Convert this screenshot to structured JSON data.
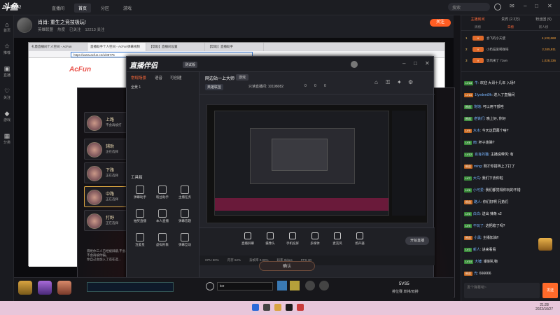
{
  "topbar": {
    "tabs": [
      "直播间",
      "首页",
      "分区",
      "游戏",
      "赛事",
      "下载"
    ],
    "search_placeholder": "搜索"
  },
  "leftnav": {
    "items": [
      "首页",
      "推荐",
      "直播",
      "关注",
      "游戏",
      "分类"
    ]
  },
  "header": {
    "room_id": "10198082",
    "title": "肖肖: 重生之竞技极玩!",
    "meta": [
      "英雄联盟",
      "热度",
      "已关注",
      "12213 关注"
    ],
    "follow_label": "关注"
  },
  "browser": {
    "tabs": [
      "礼量直播间个人空间 - AcFun",
      "直播助手个人空间 - AcFun弹幕视频",
      "【帮助】直播间设置",
      "【帮助】直播助手"
    ],
    "url": "https://www.acfun.cn/u/38775",
    "site": "AcFun"
  },
  "heroes": [
    {
      "name": "上路",
      "sub": "不会再被打"
    },
    {
      "name": "辅助",
      "sub": "正在选择"
    },
    {
      "name": "下路",
      "sub": "正在选择"
    },
    {
      "name": "中路",
      "sub": "正在选择"
    },
    {
      "name": "打野",
      "sub": "正在选择"
    }
  ],
  "assistant": {
    "logo": "直播伴侣",
    "beta": "测试版",
    "scene_tabs": [
      "常规场景",
      "语音",
      "可创建"
    ],
    "scene_item": "全景 1",
    "tools_title": "工具箱",
    "tools": [
      "弹幕助手",
      "粉丝助手",
      "主播任务",
      "抽奖直播",
      "本人直播",
      "弹幕答题",
      "连麦星",
      "虚拟形象",
      "弹幕互动"
    ],
    "room_title": "网边站一上大师",
    "room_tag": "游戏",
    "room_category": "英雄联盟",
    "room_id_label": "只读直播间: 10198082",
    "stats": [
      "0",
      "0",
      "0"
    ],
    "controls": [
      "直播屏幕",
      "摄像头",
      "手机投屏",
      "多媒体",
      "麦克风",
      "扬声器"
    ],
    "start_label": "开始直播",
    "status": [
      "CPU 30%",
      "内存 62%",
      "丢帧率 0.00%",
      "码率 0kbps",
      "FPS 30"
    ]
  },
  "game": {
    "chat_lines": [
      "隔绝你三人已经被屏蔽,不会再继续看到他们的消息",
      "不会再被你骗。",
      "你自己会加入了还在选..."
    ],
    "search_text": "ice",
    "confirm_label": "确认",
    "score": "5VS5",
    "rank_label": "排位赛 单排/双排"
  },
  "right": {
    "tabs": [
      "主播房间",
      "贵宾 (2.3万)",
      "粉丝团 (9)"
    ],
    "rank_tabs": [
      "周榜",
      "日榜",
      "新人榜"
    ],
    "rank": [
      {
        "n": "1",
        "name": "会飞的小天使",
        "score": "4,132,668"
      },
      {
        "n": "2",
        "name": "小奶猫爱喝咖啡",
        "score": "2,345,811"
      },
      {
        "n": "3",
        "name": "等风来了 71wn",
        "score": "1,028,336"
      }
    ],
    "chat": [
      {
        "badge": "LV18",
        "name": "牛",
        "text": "欢迎 大哥十几年 入场!!"
      },
      {
        "badge": "LV10",
        "name": "1fyvdent9h",
        "text": "进入了直播间"
      },
      {
        "badge": "粉丝",
        "name": "饱饱",
        "text": "可以用干部哇"
      },
      {
        "badge": "粉丝",
        "name": "老铁们",
        "text": "晚上好, 你好"
      },
      {
        "badge": "LV9",
        "name": "木木",
        "text": "今天这屏幕个啥?"
      },
      {
        "badge": "LV8",
        "name": "雨",
        "text": "杯子连弹?"
      },
      {
        "badge": "LV12",
        "name": "肖肖的猫",
        "text": "主播说带风: 有"
      },
      {
        "badge": "粉丝",
        "name": "ming",
        "text": "刚才你搭档上了打了"
      },
      {
        "badge": "LV7",
        "name": "大鸟",
        "text": "我们下去你啦"
      },
      {
        "badge": "LV6",
        "name": "小可爱",
        "text": "我们都觉得你玩的不错"
      },
      {
        "badge": "粉丝",
        "name": "路人",
        "text": "你们好啊 兄弟们"
      },
      {
        "badge": "LV5",
        "name": "白白",
        "text": "送出 辣条 x2"
      },
      {
        "badge": "LV9",
        "name": "不玩了",
        "text": "这把稳了吗?"
      },
      {
        "badge": "粉丝",
        "name": "小黑",
        "text": "主播加油!!"
      },
      {
        "badge": "LV3",
        "name": "新人",
        "text": "进来看看"
      },
      {
        "badge": "LV10",
        "name": "大锤",
        "text": "谢谢礼物"
      },
      {
        "badge": "粉丝",
        "name": "光",
        "text": "666666"
      }
    ],
    "input_placeholder": "发个弹幕吧~",
    "send_label": "发送"
  },
  "taskbar": {
    "time": "21:28",
    "date": "2022/10/27"
  }
}
